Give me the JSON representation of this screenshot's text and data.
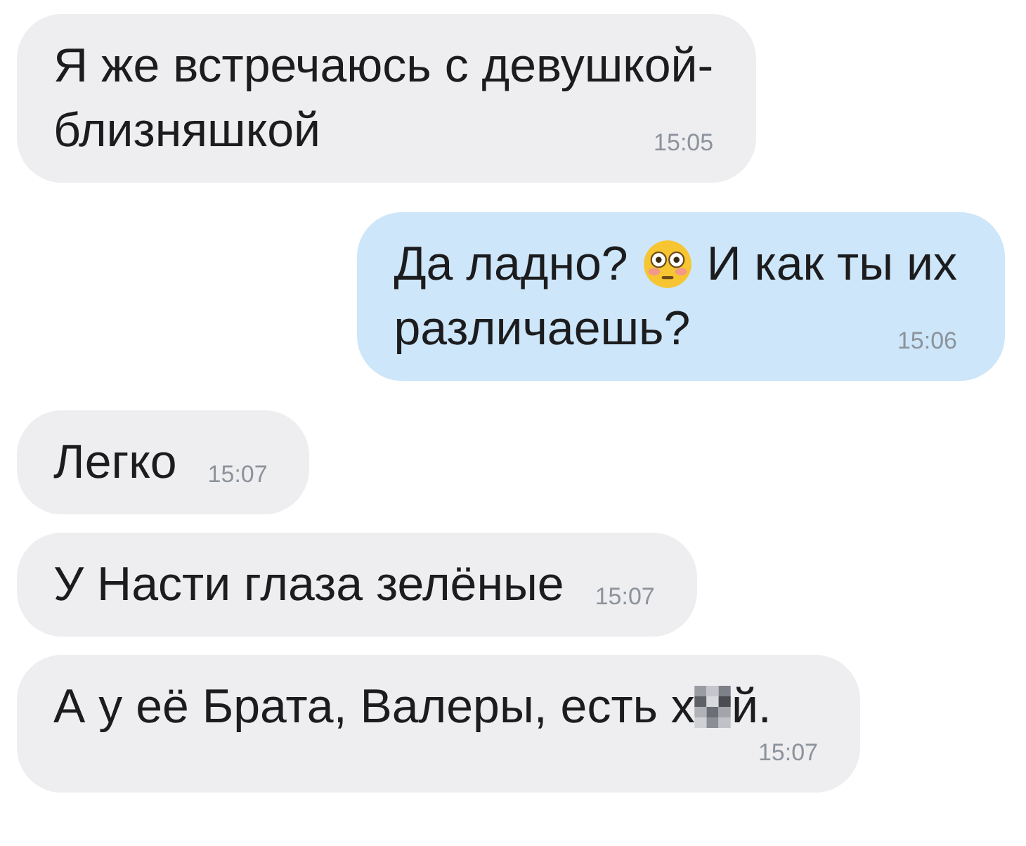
{
  "messages": [
    {
      "kind": "incoming",
      "lines": [
        [
          {
            "kind": "text",
            "text": "Я же встречаюсь с девушкой-"
          }
        ],
        [
          {
            "kind": "text",
            "text": "близняшкой"
          }
        ]
      ],
      "time": "15:05"
    },
    {
      "kind": "outgoing",
      "lines": [
        [
          {
            "kind": "text",
            "text": "Да ладно?"
          },
          {
            "kind": "emoji"
          },
          {
            "kind": "text",
            "text": "И как ты их"
          }
        ],
        [
          {
            "kind": "text",
            "text": "различаешь?"
          }
        ]
      ],
      "time": "15:06"
    },
    {
      "kind": "incoming",
      "lines": [
        [
          {
            "kind": "text",
            "text": "Легко"
          }
        ]
      ],
      "time": "15:07"
    },
    {
      "kind": "incoming",
      "lines": [
        [
          {
            "kind": "text",
            "text": "У Насти глаза зелёные"
          }
        ]
      ],
      "time": "15:07"
    },
    {
      "kind": "incoming",
      "lines": [
        [
          {
            "kind": "text",
            "text": "А у её Брата, Валеры, есть х"
          },
          {
            "kind": "censor"
          },
          {
            "kind": "text",
            "text": "й."
          }
        ]
      ],
      "time": "15:07"
    }
  ]
}
